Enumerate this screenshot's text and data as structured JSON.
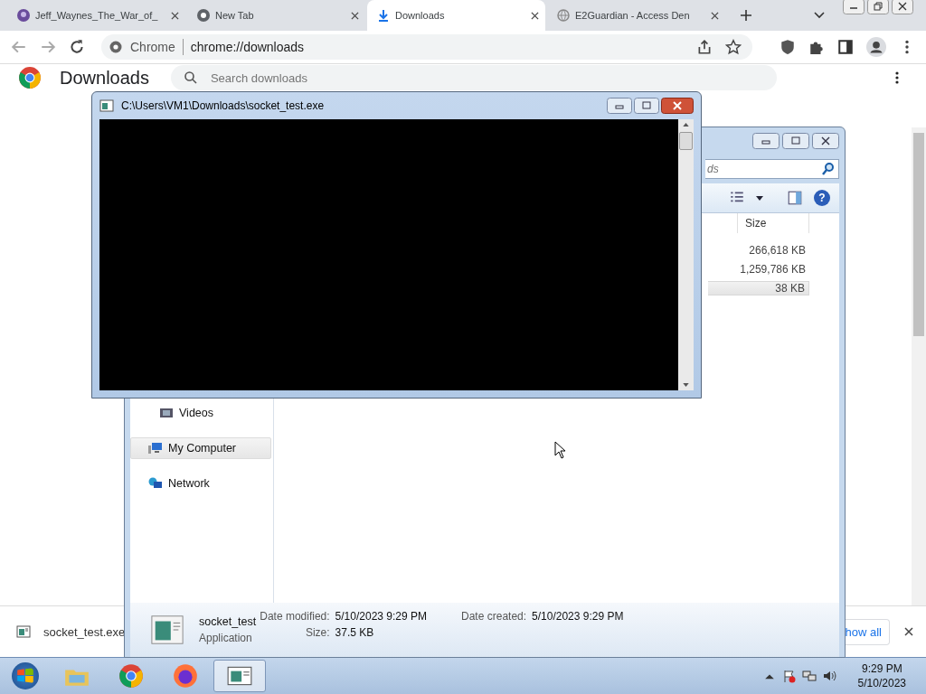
{
  "browser": {
    "tabs": [
      {
        "title": "Jeff_Waynes_The_War_of_",
        "kind": "site",
        "selected": false
      },
      {
        "title": "New Tab",
        "kind": "chrome",
        "selected": false
      },
      {
        "title": "Downloads",
        "kind": "download",
        "selected": true
      },
      {
        "title": "E2Guardian - Access Den",
        "kind": "blocked",
        "selected": false
      }
    ],
    "address": {
      "site_label": "Chrome",
      "url": "chrome://downloads"
    },
    "page": {
      "title": "Downloads",
      "search_placeholder": "Search downloads"
    },
    "download_shelf": {
      "file": "socket_test.exe",
      "show_all": "how all"
    }
  },
  "console": {
    "title": "C:\\Users\\VM1\\Downloads\\socket_test.exe"
  },
  "explorer": {
    "search_placeholder": "ds",
    "help": "?",
    "size_column": "Size",
    "rows": [
      {
        "size": "266,618 KB",
        "selected": false
      },
      {
        "size": "1,259,786 KB",
        "selected": false
      },
      {
        "size": "38 KB",
        "selected": true
      }
    ],
    "nav": [
      {
        "label": "Videos",
        "kind": "videos",
        "selected": false
      },
      {
        "label": "My Computer",
        "kind": "computer",
        "selected": true
      },
      {
        "label": "Network",
        "kind": "network",
        "selected": false
      }
    ],
    "details": {
      "name": "socket_test",
      "type": "Application",
      "modified_label": "Date modified:",
      "modified": "5/10/2023 9:29 PM",
      "size_label": "Size:",
      "size": "37.5 KB",
      "created_label": "Date created:",
      "created": "5/10/2023 9:29 PM"
    }
  },
  "taskbar": {
    "apps": [
      {
        "kind": "explorer",
        "selected": false
      },
      {
        "kind": "chrome",
        "selected": false
      },
      {
        "kind": "firefox",
        "selected": false
      },
      {
        "kind": "console",
        "selected": true
      }
    ],
    "time": "9:29 PM",
    "date": "5/10/2023"
  }
}
